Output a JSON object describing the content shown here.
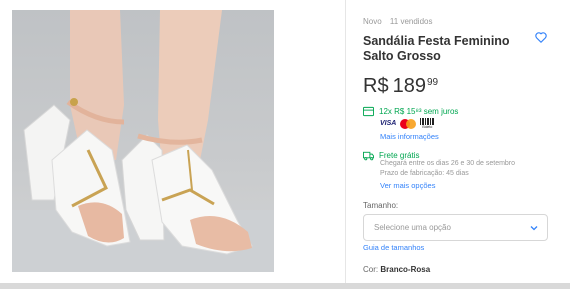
{
  "product": {
    "condition": "Novo",
    "sold": "11 vendidos",
    "title": "Sandália Festa Feminino Salto Grosso",
    "price": {
      "currency": "R$",
      "integer": "189",
      "cents": "99"
    }
  },
  "installments": {
    "text": "12x R$ 15⁸³ sem juros",
    "cards": [
      "VISA",
      "Mastercard",
      "Boleto"
    ],
    "boleto_label": "Boleto",
    "more_info": "Mais informações"
  },
  "shipping": {
    "title": "Frete grátis",
    "arrival": "Chegará entre os dias 26 e 30 de setembro",
    "production": "Prazo de fabricação: 45 dias",
    "more_link": "Ver mais opções"
  },
  "size": {
    "label": "Tamanho:",
    "placeholder": "Selecione uma opção",
    "guide_link": "Guia de tamanhos"
  },
  "color": {
    "label": "Cor:",
    "value": "Branco-Rosa"
  },
  "icons": {
    "favorite": "heart-outline-icon",
    "installments": "credit-card-icon",
    "shipping": "truck-icon",
    "dropdown": "chevron-down-icon"
  },
  "colors": {
    "accent_link": "#3483fa",
    "success_green": "#00a650",
    "text_main": "#333333",
    "text_muted": "#999999"
  }
}
